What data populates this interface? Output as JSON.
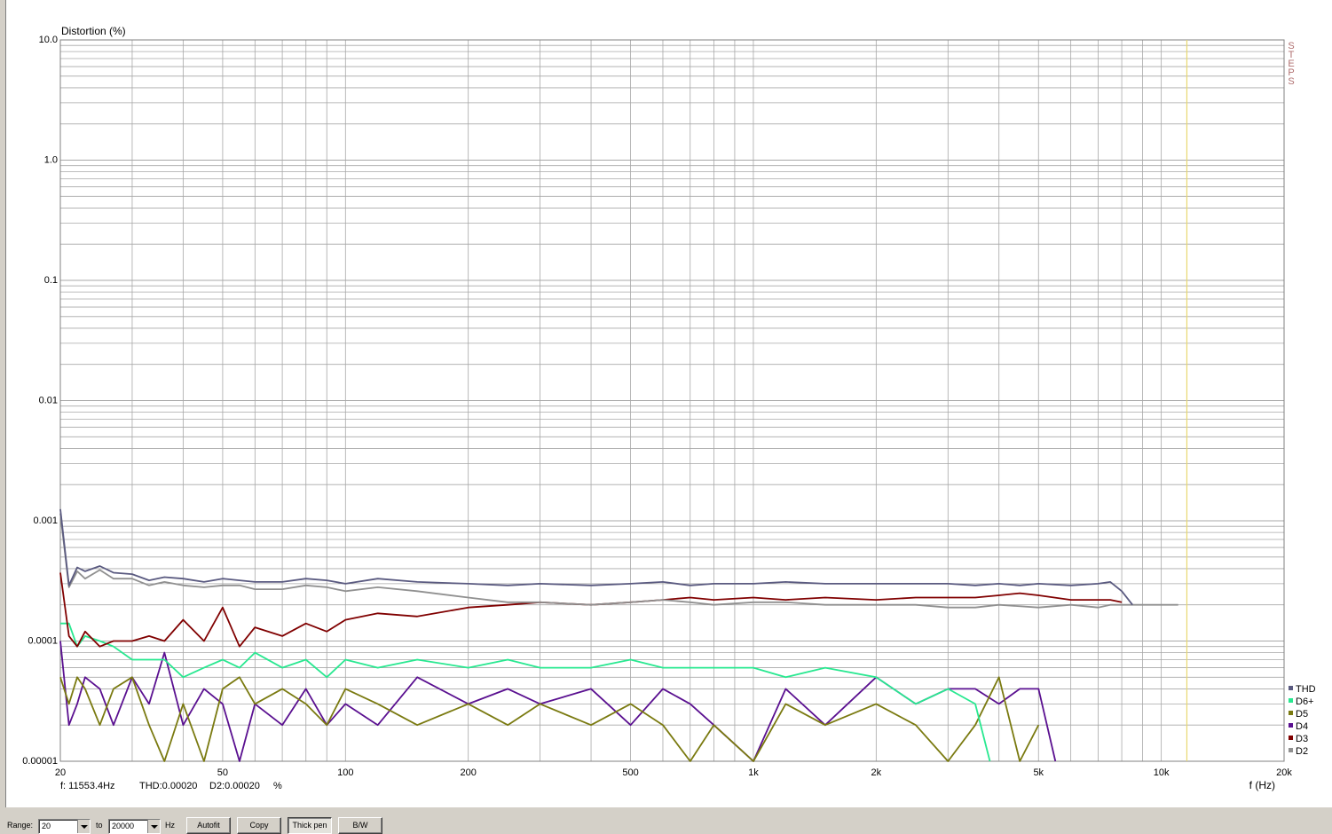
{
  "colors": {
    "grid": "#a8a8a8",
    "axis": "#808080",
    "marker": "#e8d870",
    "steps": "#b07070",
    "THD": "#5a5a80",
    "D6+": "#28e890",
    "D5": "#7a7a10",
    "D4": "#5a1090",
    "D3": "#800000",
    "D2": "#909090"
  },
  "chart_data": {
    "type": "line",
    "ylabel": "Distortion (%)",
    "xlabel": "f (Hz)",
    "xscale": "log",
    "yscale": "log",
    "xlim": [
      20,
      20000
    ],
    "ylim": [
      1e-05,
      10.0
    ],
    "yticks": [
      {
        "v": 10,
        "label": "10.0"
      },
      {
        "v": 1,
        "label": "1.0"
      },
      {
        "v": 0.1,
        "label": "0.1"
      },
      {
        "v": 0.01,
        "label": "0.01"
      },
      {
        "v": 0.001,
        "label": "0.001"
      },
      {
        "v": 0.0001,
        "label": "0.0001"
      },
      {
        "v": 1e-05,
        "label": "0.00001"
      }
    ],
    "xticks": [
      {
        "v": 20,
        "label": "20"
      },
      {
        "v": 50,
        "label": "50"
      },
      {
        "v": 100,
        "label": "100"
      },
      {
        "v": 200,
        "label": "200"
      },
      {
        "v": 500,
        "label": "500"
      },
      {
        "v": 1000,
        "label": "1k"
      },
      {
        "v": 2000,
        "label": "2k"
      },
      {
        "v": 5000,
        "label": "5k"
      },
      {
        "v": 10000,
        "label": "10k"
      },
      {
        "v": 20000,
        "label": "20k"
      }
    ],
    "marker_x": 11553.4,
    "side_label": "STEPS",
    "grid": true,
    "legend_position": "bottom-right",
    "series": [
      {
        "name": "THD",
        "x": [
          20,
          21,
          22,
          23,
          25,
          27,
          30,
          33,
          36,
          40,
          45,
          50,
          55,
          60,
          70,
          80,
          90,
          100,
          120,
          150,
          200,
          250,
          300,
          400,
          500,
          600,
          700,
          800,
          1000,
          1200,
          1500,
          2000,
          2500,
          3000,
          3500,
          4000,
          4500,
          5000,
          6000,
          7000,
          7500,
          8000,
          8500
        ],
        "y": [
          0.00125,
          0.00029,
          0.00041,
          0.00038,
          0.00042,
          0.00037,
          0.00036,
          0.00032,
          0.00034,
          0.00033,
          0.00031,
          0.00033,
          0.00032,
          0.00031,
          0.00031,
          0.00033,
          0.00032,
          0.0003,
          0.00033,
          0.00031,
          0.0003,
          0.00029,
          0.0003,
          0.00029,
          0.0003,
          0.00031,
          0.00029,
          0.0003,
          0.0003,
          0.00031,
          0.0003,
          0.0003,
          0.0003,
          0.0003,
          0.00029,
          0.0003,
          0.00029,
          0.0003,
          0.00029,
          0.0003,
          0.00031,
          0.00026,
          0.0002
        ]
      },
      {
        "name": "D2",
        "x": [
          20,
          21,
          22,
          23,
          25,
          27,
          30,
          33,
          36,
          40,
          45,
          50,
          55,
          60,
          70,
          80,
          90,
          100,
          120,
          150,
          200,
          250,
          300,
          400,
          500,
          600,
          700,
          800,
          1000,
          1200,
          1500,
          2000,
          2500,
          3000,
          3500,
          4000,
          5000,
          6000,
          7000,
          7500,
          8000,
          9000,
          10000,
          11000
        ],
        "y": [
          0.00115,
          0.00028,
          0.00038,
          0.00033,
          0.00039,
          0.00033,
          0.00033,
          0.00029,
          0.00031,
          0.00029,
          0.00028,
          0.00029,
          0.00029,
          0.00027,
          0.00027,
          0.00029,
          0.00028,
          0.00026,
          0.00028,
          0.00026,
          0.00023,
          0.00021,
          0.00021,
          0.0002,
          0.00021,
          0.00022,
          0.00021,
          0.0002,
          0.00021,
          0.00021,
          0.0002,
          0.0002,
          0.0002,
          0.00019,
          0.00019,
          0.0002,
          0.00019,
          0.0002,
          0.00019,
          0.0002,
          0.0002,
          0.0002,
          0.0002,
          0.0002
        ]
      },
      {
        "name": "D3",
        "x": [
          20,
          21,
          22,
          23,
          25,
          27,
          30,
          33,
          36,
          40,
          45,
          50,
          55,
          60,
          70,
          80,
          90,
          100,
          120,
          150,
          200,
          250,
          300,
          400,
          500,
          600,
          700,
          800,
          1000,
          1200,
          1500,
          2000,
          2500,
          3000,
          3500,
          4000,
          4500,
          5000,
          6000,
          7000,
          7500,
          8000
        ],
        "y": [
          0.00037,
          0.00011,
          9e-05,
          0.00012,
          9e-05,
          0.0001,
          0.0001,
          0.00011,
          0.0001,
          0.00015,
          0.0001,
          0.00019,
          9e-05,
          0.00013,
          0.00011,
          0.00014,
          0.00012,
          0.00015,
          0.00017,
          0.00016,
          0.00019,
          0.0002,
          0.00021,
          0.0002,
          0.00021,
          0.00022,
          0.00023,
          0.00022,
          0.00023,
          0.00022,
          0.00023,
          0.00022,
          0.00023,
          0.00023,
          0.00023,
          0.00024,
          0.00025,
          0.00024,
          0.00022,
          0.00022,
          0.00022,
          0.00021
        ]
      },
      {
        "name": "D6+",
        "x": [
          20,
          21,
          22,
          23,
          25,
          27,
          30,
          33,
          36,
          40,
          45,
          50,
          55,
          60,
          70,
          80,
          90,
          100,
          120,
          150,
          200,
          250,
          300,
          400,
          500,
          600,
          700,
          800,
          1000,
          1200,
          1500,
          2000,
          2500,
          3000,
          3500,
          3800
        ],
        "y": [
          0.00014,
          0.00014,
          9e-05,
          0.00011,
          0.0001,
          9e-05,
          7e-05,
          7e-05,
          7e-05,
          5e-05,
          6e-05,
          7e-05,
          6e-05,
          8e-05,
          6e-05,
          7e-05,
          5e-05,
          7e-05,
          6e-05,
          7e-05,
          6e-05,
          7e-05,
          6e-05,
          6e-05,
          7e-05,
          6e-05,
          6e-05,
          6e-05,
          6e-05,
          5e-05,
          6e-05,
          5e-05,
          3e-05,
          4e-05,
          3e-05,
          1e-05
        ]
      },
      {
        "name": "D5",
        "x": [
          20,
          21,
          22,
          23,
          25,
          27,
          30,
          33,
          36,
          40,
          45,
          50,
          55,
          60,
          70,
          80,
          90,
          100,
          120,
          150,
          200,
          250,
          300,
          400,
          500,
          600,
          700,
          800,
          1000,
          1200,
          1500,
          2000,
          2500,
          3000,
          3500,
          4000,
          4500,
          5000
        ],
        "y": [
          5e-05,
          3e-05,
          5e-05,
          4e-05,
          2e-05,
          4e-05,
          5e-05,
          2e-05,
          1e-05,
          3e-05,
          1e-05,
          4e-05,
          5e-05,
          3e-05,
          4e-05,
          3e-05,
          2e-05,
          4e-05,
          3e-05,
          2e-05,
          3e-05,
          2e-05,
          3e-05,
          2e-05,
          3e-05,
          2e-05,
          1e-05,
          2e-05,
          1e-05,
          3e-05,
          2e-05,
          3e-05,
          2e-05,
          1e-05,
          2e-05,
          5e-05,
          1e-05,
          2e-05
        ]
      },
      {
        "name": "D4",
        "x": [
          20,
          21,
          22,
          23,
          25,
          27,
          30,
          33,
          36,
          40,
          45,
          50,
          55,
          60,
          70,
          80,
          90,
          100,
          120,
          150,
          200,
          250,
          300,
          400,
          500,
          600,
          700,
          800,
          1000,
          1200,
          1500,
          2000,
          2500,
          3000,
          3500,
          4000,
          4500,
          5000,
          5500
        ],
        "y": [
          0.0001,
          2e-05,
          3e-05,
          5e-05,
          4e-05,
          2e-05,
          5e-05,
          3e-05,
          8e-05,
          2e-05,
          4e-05,
          3e-05,
          1e-05,
          3e-05,
          2e-05,
          4e-05,
          2e-05,
          3e-05,
          2e-05,
          5e-05,
          3e-05,
          4e-05,
          3e-05,
          4e-05,
          2e-05,
          4e-05,
          3e-05,
          2e-05,
          1e-05,
          4e-05,
          2e-05,
          5e-05,
          3e-05,
          4e-05,
          4e-05,
          3e-05,
          4e-05,
          4e-05,
          1e-05
        ]
      }
    ]
  },
  "legend": [
    "THD",
    "D6+",
    "D5",
    "D4",
    "D3",
    "D2"
  ],
  "status": {
    "freq": "f: 11553.4Hz",
    "thd": "THD:0.00020",
    "d2": "D2:0.00020",
    "unit": "%"
  },
  "toolbar": {
    "range_label": "Range:",
    "range_from": "20",
    "to_label": "to",
    "range_to": "20000",
    "hz_label": "Hz",
    "autofit": "Autofit",
    "copy": "Copy",
    "thick_pen": "Thick pen",
    "bw": "B/W"
  }
}
